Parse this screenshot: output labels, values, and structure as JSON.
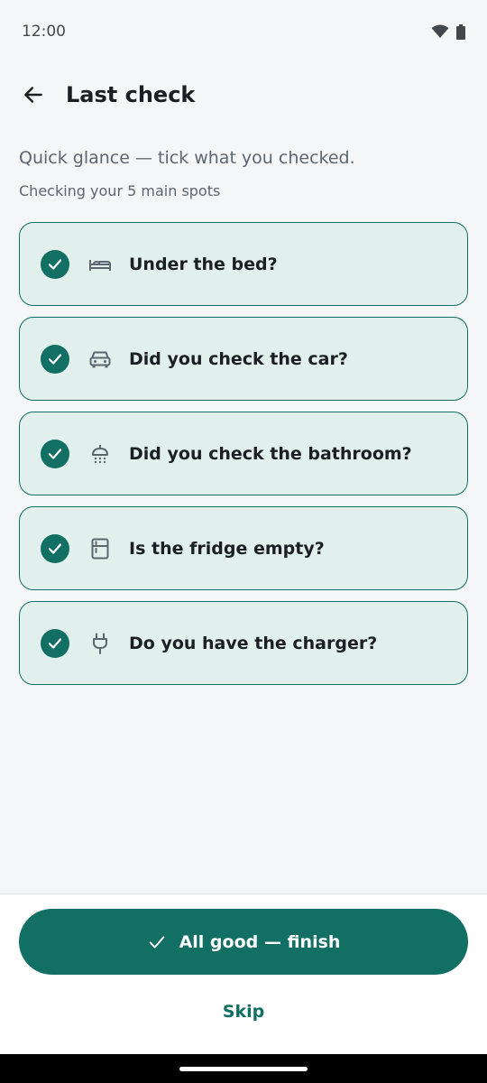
{
  "status_bar": {
    "time": "12:00"
  },
  "app_bar": {
    "title": "Last check"
  },
  "intro": {
    "text": "Quick glance — tick what you checked.",
    "subtext": "Checking your 5 main spots"
  },
  "checklist": {
    "items": [
      {
        "label": "Under the bed?",
        "icon": "bed-icon",
        "checked": true
      },
      {
        "label": "Did you check the car?",
        "icon": "car-icon",
        "checked": true
      },
      {
        "label": "Did you check the bathroom?",
        "icon": "shower-icon",
        "checked": true
      },
      {
        "label": "Is the fridge empty?",
        "icon": "fridge-icon",
        "checked": true
      },
      {
        "label": "Do you have the charger?",
        "icon": "plug-icon",
        "checked": true
      }
    ]
  },
  "actions": {
    "primary_label": "All good — finish",
    "skip_label": "Skip"
  },
  "colors": {
    "accent": "#126f63",
    "item_background": "#e1f0ed",
    "page_background": "#f4f6f8"
  }
}
